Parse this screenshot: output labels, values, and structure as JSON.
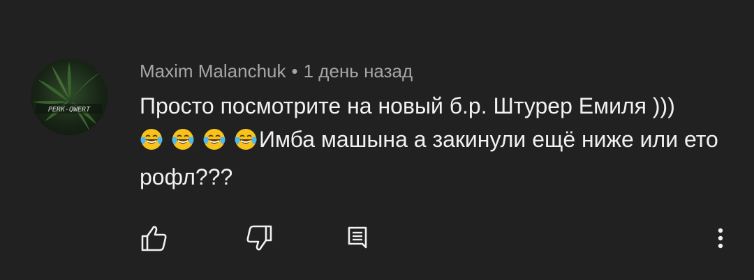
{
  "comment": {
    "author": "Maxim Malanchuk",
    "separator": "•",
    "timestamp": "1 день назад",
    "text_part1": "Просто посмотрите на новый б.р. Штурер Емиля )))",
    "emoji": [
      "😂",
      "😂",
      "😂",
      "😂"
    ],
    "text_part2": "Имба машына а закинули ещё ниже или ето рофл???",
    "avatar_text": "PERK-QWERT"
  },
  "actions": [
    {
      "name": "like-icon"
    },
    {
      "name": "dislike-icon"
    },
    {
      "name": "reply-icon"
    },
    {
      "name": "more-vert-icon"
    }
  ],
  "colors": {
    "background": "#212121",
    "meta": "#a6a6a6",
    "text": "#f1f1f1",
    "icons": "#f1f1f1"
  }
}
